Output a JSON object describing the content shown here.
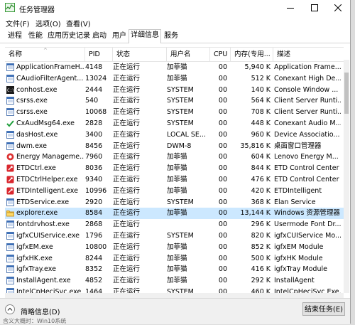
{
  "window": {
    "title": "任务管理器"
  },
  "menu": [
    "文件(F)",
    "选项(O)",
    "查看(V)"
  ],
  "tabs": [
    "进程",
    "性能",
    "应用历史记录",
    "启动",
    "用户",
    "详细信息",
    "服务"
  ],
  "active_tab": "详细信息",
  "columns": {
    "name": "名称",
    "pid": "PID",
    "status": "状态",
    "user": "用户名",
    "cpu": "CPU",
    "mem": "内存(专用...",
    "desc": "描述"
  },
  "rows": [
    {
      "icon": "blue-window",
      "name": "ApplicationFrameH...",
      "pid": "4148",
      "status": "正在运行",
      "user": "加菲猫",
      "cpu": "00",
      "mem": "5,940 K",
      "desc": "Application Frame..."
    },
    {
      "icon": "blue-window",
      "name": "CAudioFilterAgent...",
      "pid": "13024",
      "status": "正在运行",
      "user": "加菲猫",
      "cpu": "00",
      "mem": "512 K",
      "desc": "Conexant High De..."
    },
    {
      "icon": "console",
      "name": "conhost.exe",
      "pid": "2444",
      "status": "正在运行",
      "user": "SYSTEM",
      "cpu": "00",
      "mem": "140 K",
      "desc": "Console Window ..."
    },
    {
      "icon": "blue-window",
      "name": "csrss.exe",
      "pid": "540",
      "status": "正在运行",
      "user": "SYSTEM",
      "cpu": "00",
      "mem": "564 K",
      "desc": "Client Server Runti..."
    },
    {
      "icon": "blue-window",
      "name": "csrss.exe",
      "pid": "10068",
      "status": "正在运行",
      "user": "SYSTEM",
      "cpu": "00",
      "mem": "708 K",
      "desc": "Client Server Runti..."
    },
    {
      "icon": "green-check",
      "name": "CxAudMsg64.exe",
      "pid": "2828",
      "status": "正在运行",
      "user": "SYSTEM",
      "cpu": "00",
      "mem": "448 K",
      "desc": "Conexant Audio M..."
    },
    {
      "icon": "blue-window",
      "name": "dasHost.exe",
      "pid": "3400",
      "status": "正在运行",
      "user": "LOCAL SE...",
      "cpu": "00",
      "mem": "960 K",
      "desc": "Device Associatio..."
    },
    {
      "icon": "blue-window",
      "name": "dwm.exe",
      "pid": "8456",
      "status": "正在运行",
      "user": "DWM-8",
      "cpu": "00",
      "mem": "35,816 K",
      "desc": "桌面窗口管理器"
    },
    {
      "icon": "red-round",
      "name": "Energy Manageme...",
      "pid": "7960",
      "status": "正在运行",
      "user": "加菲猫",
      "cpu": "00",
      "mem": "604 K",
      "desc": "Lenovo Energy M..."
    },
    {
      "icon": "red-tool",
      "name": "ETDCtrl.exe",
      "pid": "8036",
      "status": "正在运行",
      "user": "加菲猫",
      "cpu": "00",
      "mem": "844 K",
      "desc": "ETD Control Center"
    },
    {
      "icon": "red-tool",
      "name": "ETDCtrlHelper.exe",
      "pid": "9340",
      "status": "正在运行",
      "user": "加菲猫",
      "cpu": "00",
      "mem": "476 K",
      "desc": "ETD Control Center"
    },
    {
      "icon": "red-tool",
      "name": "ETDIntelligent.exe",
      "pid": "10996",
      "status": "正在运行",
      "user": "加菲猫",
      "cpu": "00",
      "mem": "420 K",
      "desc": "ETDIntelligent"
    },
    {
      "icon": "blue-window",
      "name": "ETDService.exe",
      "pid": "2920",
      "status": "正在运行",
      "user": "SYSTEM",
      "cpu": "00",
      "mem": "368 K",
      "desc": "Elan Service"
    },
    {
      "icon": "folder",
      "name": "explorer.exe",
      "pid": "8584",
      "status": "正在运行",
      "user": "加菲猫",
      "cpu": "00",
      "mem": "13,144 K",
      "desc": "Windows 资源管理器",
      "selected": true
    },
    {
      "icon": "blue-window",
      "name": "fontdrvhost.exe",
      "pid": "2868",
      "status": "正在运行",
      "user": "",
      "cpu": "00",
      "mem": "296 K",
      "desc": "Usermode Font Dr..."
    },
    {
      "icon": "blue-window",
      "name": "igfxCUIService.exe",
      "pid": "1796",
      "status": "正在运行",
      "user": "SYSTEM",
      "cpu": "00",
      "mem": "820 K",
      "desc": "igfxCUIService Mo..."
    },
    {
      "icon": "blue-window",
      "name": "igfxEM.exe",
      "pid": "10800",
      "status": "正在运行",
      "user": "加菲猫",
      "cpu": "00",
      "mem": "852 K",
      "desc": "igfxEM Module"
    },
    {
      "icon": "blue-window",
      "name": "igfxHK.exe",
      "pid": "8244",
      "status": "正在运行",
      "user": "加菲猫",
      "cpu": "00",
      "mem": "500 K",
      "desc": "igfxHK Module"
    },
    {
      "icon": "blue-window",
      "name": "igfxTray.exe",
      "pid": "8352",
      "status": "正在运行",
      "user": "加菲猫",
      "cpu": "00",
      "mem": "416 K",
      "desc": "igfxTray Module"
    },
    {
      "icon": "blue-window",
      "name": "InstallAgent.exe",
      "pid": "4852",
      "status": "正在运行",
      "user": "加菲猫",
      "cpu": "00",
      "mem": "292 K",
      "desc": "InstallAgent"
    },
    {
      "icon": "blue-window",
      "name": "IntelCpHeciSvc.exe",
      "pid": "1464",
      "status": "正在运行",
      "user": "SYSTEM",
      "cpu": "00",
      "mem": "460 K",
      "desc": "IntelCpHeciSvc Exe..."
    }
  ],
  "footer": {
    "fewer_details": "简略信息(D)",
    "end_task": "结束任务(E)"
  },
  "background": {
    "text": "含义大概时：Win10系统"
  }
}
